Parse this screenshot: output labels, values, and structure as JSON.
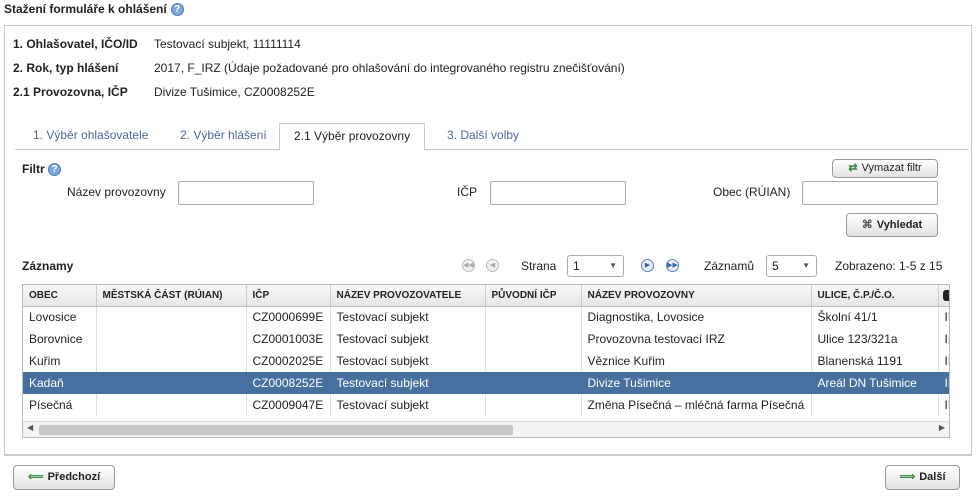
{
  "title": "Stažení formuláře k ohlášení",
  "info": [
    {
      "label": "1. Ohlašovatel, IČO/ID",
      "value": "Testovací subjekt, 11111114"
    },
    {
      "label": "2. Rok, typ hlášení",
      "value": "2017, F_IRZ (Údaje požadované pro ohlašování do integrovaného registru znečišťování)"
    },
    {
      "label": "2.1 Provozovna, IČP",
      "value": "Divize Tušimice, CZ0008252E"
    }
  ],
  "tabs": [
    {
      "label": "1. Výběr ohlašovatele"
    },
    {
      "label": "2. Výběr hlášení"
    },
    {
      "label": "2.1 Výběr provozovny"
    },
    {
      "label": "3. Další volby"
    }
  ],
  "filter": {
    "label": "Filtr",
    "clear_button": "Vymazat filtr",
    "fields": [
      {
        "label": "Název provozovny",
        "value": ""
      },
      {
        "label": "IČP",
        "value": ""
      },
      {
        "label": "Obec (RÚIAN)",
        "value": ""
      }
    ],
    "search_button": "Vyhledat"
  },
  "records": {
    "label": "Záznamy",
    "page_label": "Strana",
    "page_value": "1",
    "count_label": "Záznamů",
    "count_value": "5",
    "shown": "Zobrazeno: 1-5 z 15"
  },
  "table": {
    "columns": [
      "OBEC",
      "MĚSTSKÁ ČÁST (RÚIAN)",
      "IČP",
      "NÁZEV PROVOZOVATELE",
      "PŮVODNÍ IČP",
      "NÁZEV PROVOZOVNY",
      "ULICE, Č.P./Č.O."
    ],
    "rows": [
      [
        "Lovosice",
        "",
        "CZ0000699E",
        "Testovací subjekt",
        "",
        "Diagnostika, Lovosice",
        "Školní 41/1",
        "IF"
      ],
      [
        "Borovnice",
        "",
        "CZ0001003E",
        "Testovací subjekt",
        "",
        "Provozovna testovací IRZ",
        "Ulice 123/321a",
        "IF"
      ],
      [
        "Kuřim",
        "",
        "CZ0002025E",
        "Testovací subjekt",
        "",
        "Věznice Kuřim",
        "Blanenská 1191",
        "IF"
      ],
      [
        "Kadaň",
        "",
        "CZ0008252E",
        "Testovací subjekt",
        "",
        "Divize Tušimice",
        "Areál DN Tušimice",
        "IF"
      ],
      [
        "Písečná",
        "",
        "CZ0009047E",
        "Testovací subjekt",
        "",
        "Změna Písečná – mléčná farma Písečná",
        "",
        "IF"
      ]
    ],
    "selected_row": 3
  },
  "footer": {
    "prev_button": "Předchozí",
    "next_button": "Další"
  },
  "colors": {
    "selected_row": "#47709e",
    "tab_link": "#4a6a9a",
    "button_icon": "#3a8a3a"
  }
}
